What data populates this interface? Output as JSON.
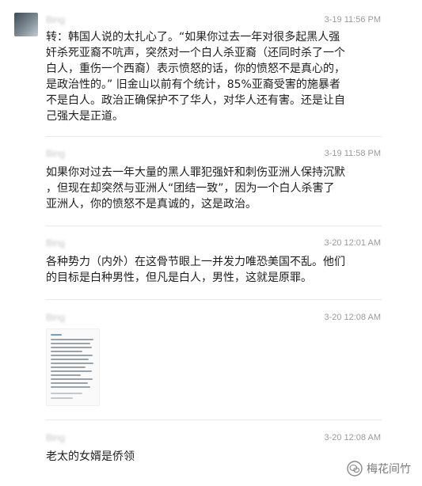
{
  "comments": [
    {
      "username": "Bing",
      "timestamp": "3-19 11:56 PM",
      "text": "转：韩国人说的太扎心了。“如果你过去一年对很多起黑人强\n奸杀死亚裔不吭声，突然对一个白人杀亚裔（还同时杀了一个\n白人，重伤一个西裔）表示愤怒的话，你的愤怒不是真心的，\n是政治性的。” 旧金山以前有个统计，85%亚裔受害的施暴者\n不是白人。政治正确保护不了华人，对华人还有害。还是让自\n己强大是正道。"
    },
    {
      "username": "Bing",
      "timestamp": "3-19 11:58 PM",
      "text": "如果你对过去一年大量的黑人罪犯强奸和刺伤亚洲人保持沉默\n，但现在却突然与亚洲人“团结一致”，因为一个白人杀害了\n亚洲人，你的愤怒不是真诚的，这是政治。"
    },
    {
      "username": "Bing",
      "timestamp": "3-20 12:01 AM",
      "text": "各种势力（内外）在这骨节眼上一并发力唯恐美国不乱。他们\n的目标是白种男性，但凡是白人，男性，这就是原罪。"
    },
    {
      "username": "Bing",
      "timestamp": "3-20 12:08 AM",
      "text": ""
    },
    {
      "username": "Bing",
      "timestamp": "3-20 12:08 AM",
      "text": "老太的女婿是侨领"
    }
  ],
  "watermark": {
    "icon": "wechat-icon",
    "label": "梅花间竹"
  }
}
